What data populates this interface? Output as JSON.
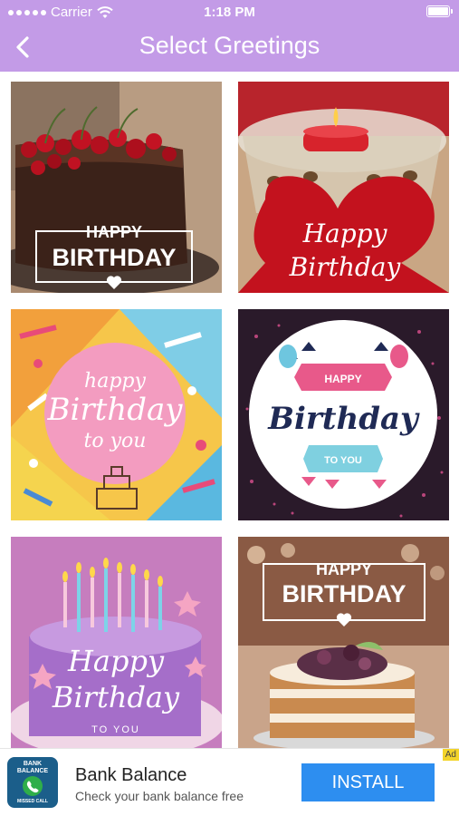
{
  "status_bar": {
    "carrier": "Carrier",
    "time": "1:18 PM"
  },
  "nav": {
    "title": "Select Greetings"
  },
  "cards": [
    {
      "line1": "HAPPY",
      "line2": "BIRTHDAY"
    },
    {
      "line1": "Happy",
      "line2": "Birthday"
    },
    {
      "line1": "happy",
      "line2": "Birthday",
      "line3": "to you"
    },
    {
      "line1": "HAPPY",
      "line2": "Birthday",
      "line3": "TO YOU"
    },
    {
      "line1": "Happy",
      "line2": "Birthday",
      "line3": "TO YOU"
    },
    {
      "line1": "HAPPY",
      "line2": "BIRTHDAY"
    }
  ],
  "ad": {
    "app_icon_lines": [
      "BANK",
      "BALANCE",
      "MISSED CALL"
    ],
    "title": "Bank Balance",
    "subtitle": "Check your bank balance free",
    "install_label": "INSTALL",
    "badge": "Ad"
  }
}
